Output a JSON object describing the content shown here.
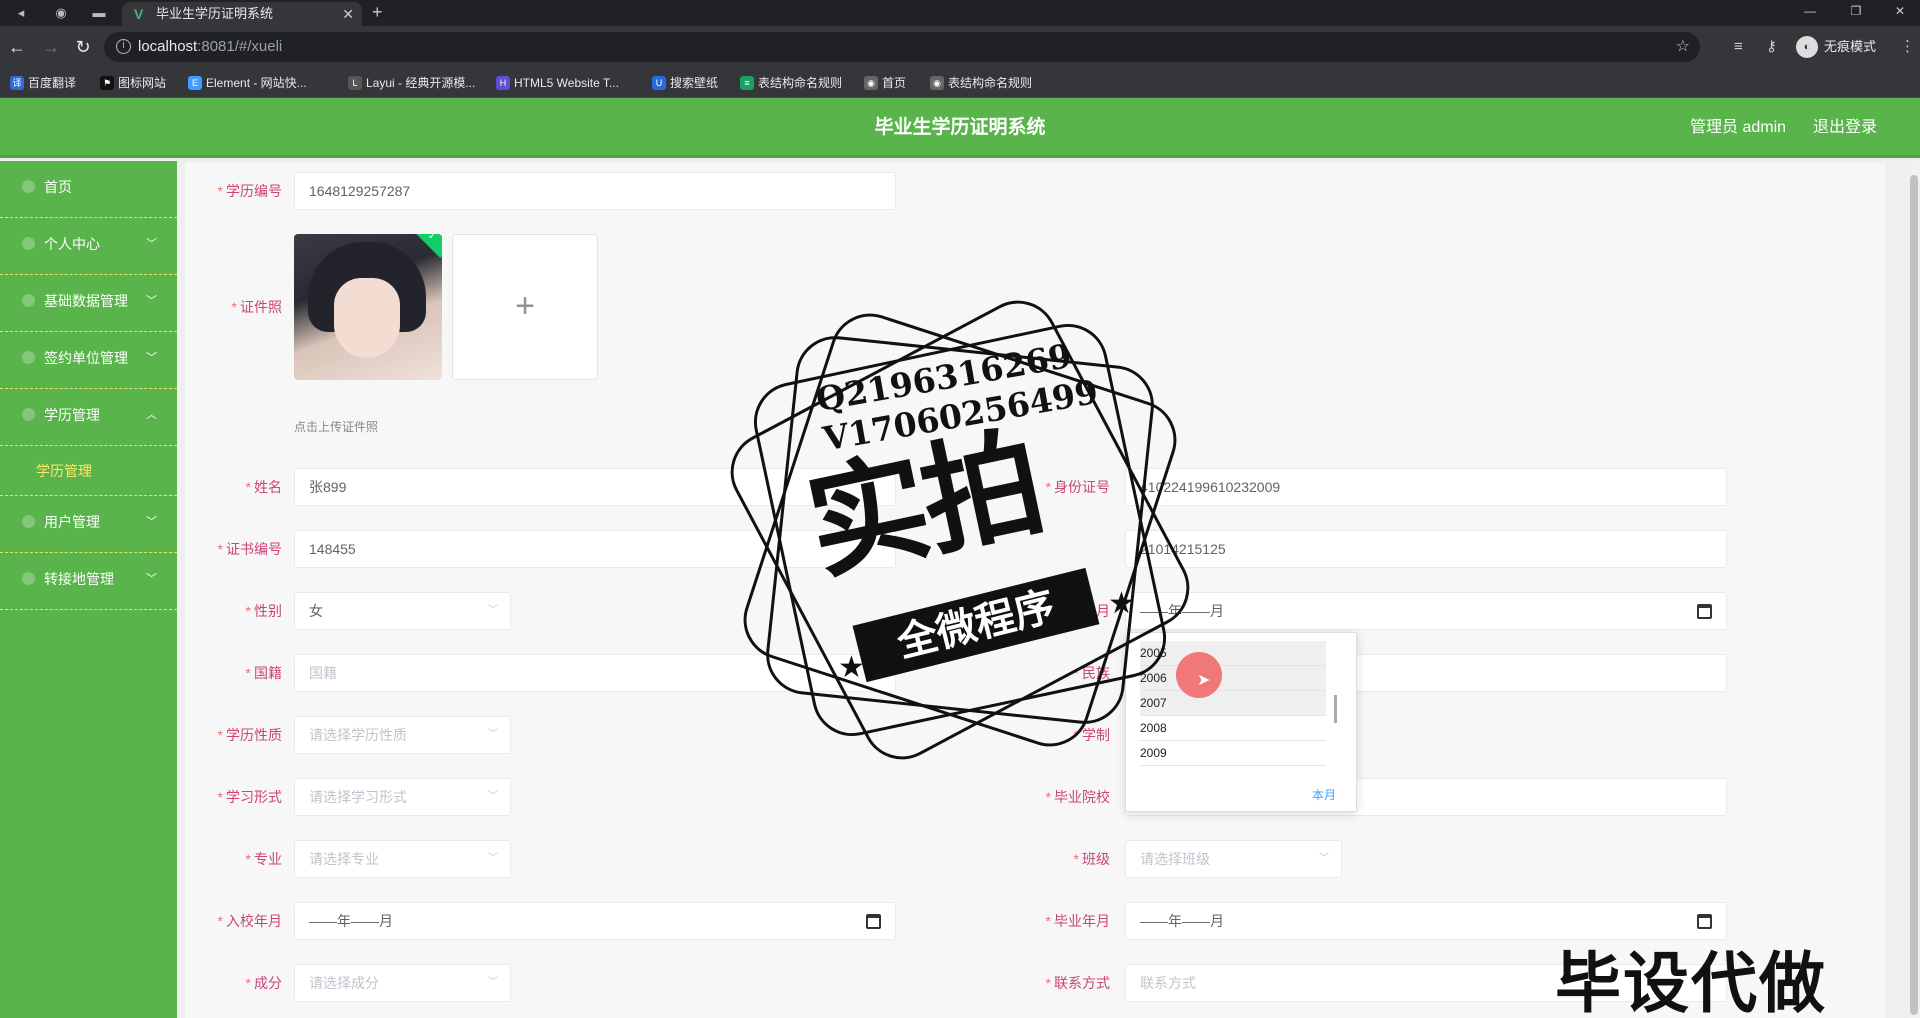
{
  "browser": {
    "tab_title": "毕业生学历证明系统",
    "url_host": "localhost",
    "url_rest": ":8081/#/xueli",
    "incognito_label": "无痕模式",
    "bookmarks": [
      "百度翻译",
      "图标网站",
      "Element - 网站快...",
      "Layui - 经典开源模...",
      "HTML5 Website T...",
      "搜索壁纸",
      "表结构命名规则",
      "首页",
      "表结构命名规则"
    ]
  },
  "header": {
    "title": "毕业生学历证明系统",
    "user": "管理员 admin",
    "logout": "退出登录"
  },
  "sidebar": {
    "items": [
      {
        "label": "首页",
        "arrow": ""
      },
      {
        "label": "个人中心",
        "arrow": "﹀"
      },
      {
        "label": "基础数据管理",
        "arrow": "﹀"
      },
      {
        "label": "签约单位管理",
        "arrow": "﹀"
      },
      {
        "label": "学历管理",
        "arrow": "︿"
      },
      {
        "label": "用户管理",
        "arrow": "﹀"
      },
      {
        "label": "转接地管理",
        "arrow": "﹀"
      }
    ],
    "sub_item": "学历管理"
  },
  "form": {
    "xueli_no": {
      "label": "学历编号",
      "value": "1648129257287"
    },
    "photo": {
      "label": "证件照",
      "hint": "点击上传证件照",
      "upload_symbol": "+"
    },
    "name": {
      "label": "姓名",
      "value": "张899"
    },
    "id_card": {
      "label": "身份证号",
      "value": "410224199610232009"
    },
    "cert_no": {
      "label": "证书编号",
      "value": "148455"
    },
    "other_no": {
      "label": "",
      "value": "21014215125"
    },
    "gender": {
      "label": "性别",
      "value": "女"
    },
    "birth": {
      "label": "出生年月",
      "value": "——年——月"
    },
    "nationality": {
      "label": "国籍",
      "placeholder": "国籍"
    },
    "ethnicity": {
      "label": "民族",
      "placeholder": ""
    },
    "edu_nature": {
      "label": "学历性质",
      "placeholder": "请选择学历性质"
    },
    "edu_system": {
      "label": "学制",
      "placeholder": ""
    },
    "study_form": {
      "label": "学习形式",
      "placeholder": "请选择学习形式"
    },
    "school": {
      "label": "毕业院校",
      "placeholder": ""
    },
    "major": {
      "label": "专业",
      "placeholder": "请选择专业"
    },
    "class": {
      "label": "班级",
      "placeholder": "请选择班级"
    },
    "enroll": {
      "label": "入校年月",
      "value": "——年——月"
    },
    "graduate": {
      "label": "毕业年月",
      "value": "——年——月"
    },
    "composition": {
      "label": "成分",
      "placeholder": "请选择成分"
    },
    "contact": {
      "label": "联系方式",
      "placeholder": "联系方式"
    }
  },
  "date_picker": {
    "years": [
      "2005",
      "2006",
      "2007",
      "2008",
      "2009"
    ],
    "this_month": "本月"
  },
  "watermark": {
    "line1": "Q2196316269",
    "line2": "V17060256499",
    "big": "实拍",
    "ribbon": "全微程序",
    "corner": "毕设代做"
  },
  "colors": {
    "header": "#5ab44c",
    "label": "#c9457a",
    "required": "#f56c6c",
    "sub_active": "#ffe86b"
  }
}
